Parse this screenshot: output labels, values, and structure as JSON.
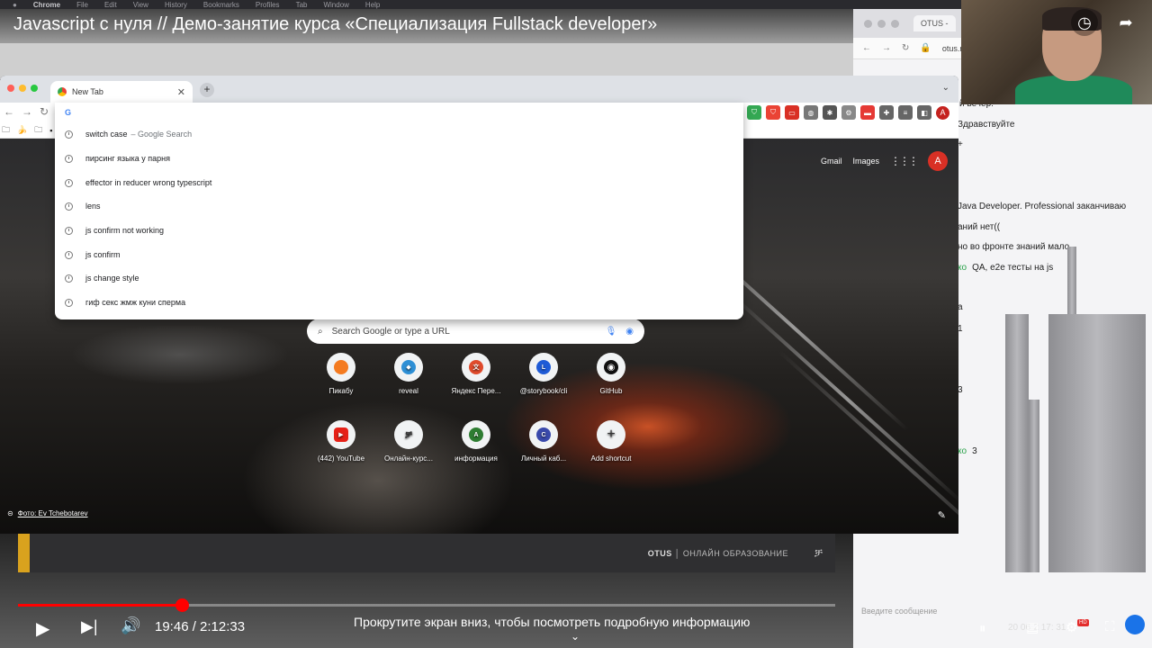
{
  "mac_menu": {
    "items": [
      "Chrome",
      "File",
      "Edit",
      "View",
      "History",
      "Bookmarks",
      "Profiles",
      "Tab",
      "Window",
      "Help"
    ]
  },
  "video": {
    "title": "Javascript с нуля // Демо-занятие курса «Специализация Fullstack developer»",
    "time_current": "19:46",
    "time_total": "2:12:33",
    "time_display": "19:46 / 2:12:33",
    "progress": 0.2,
    "scroll_hint": "Прокрутите экран вниз, чтобы посмотреть подробную информацию",
    "hd_badge": "HD",
    "brand_name": "OTUS",
    "brand_tagline": "ОНЛАЙН ОБРАЗОВАНИЕ"
  },
  "browser": {
    "tab_title": "New Tab",
    "omnibox_letter": "G",
    "profile_initial": "A",
    "suggestions": [
      {
        "text": "switch case",
        "suffix": "– Google Search"
      },
      {
        "text": "пирсинг языка у парня",
        "suffix": ""
      },
      {
        "text": "effector in reducer wrong typescript",
        "suffix": ""
      },
      {
        "text": "lens",
        "suffix": ""
      },
      {
        "text": "js confirm not working",
        "suffix": ""
      },
      {
        "text": "js confirm",
        "suffix": ""
      },
      {
        "text": "js change style",
        "suffix": ""
      },
      {
        "text": "гиф секс жмж куни сперма",
        "suffix": ""
      }
    ]
  },
  "ntp": {
    "links": {
      "gmail": "Gmail",
      "images": "Images"
    },
    "avatar_initial": "A",
    "search_placeholder": "Search Google or type a URL",
    "shortcuts_row1": [
      {
        "label": "Пикабу",
        "icon": "pikabu-icon",
        "color": "#f47b20",
        "glyph": ""
      },
      {
        "label": "reveal",
        "icon": "reveal-icon",
        "color": "#2d8fd5",
        "glyph": "◆"
      },
      {
        "label": "Яндекс Пере...",
        "icon": "yandex-translate-icon",
        "color": "#e04b2c",
        "glyph": "文"
      },
      {
        "label": "@storybook/cli",
        "icon": "storybook-icon",
        "color": "#1e5bd6",
        "glyph": "L"
      },
      {
        "label": "GitHub",
        "icon": "github-icon",
        "color": "#ffffff",
        "glyph": "◉"
      }
    ],
    "shortcuts_row2": [
      {
        "label": "(442) YouTube",
        "icon": "youtube-icon",
        "color": "#e62117",
        "glyph": "▶"
      },
      {
        "label": "Онлайн-курс...",
        "icon": "otus-icon",
        "color": "#f1f3f4",
        "glyph": "ቻ"
      },
      {
        "label": "информация",
        "icon": "letter-a-icon",
        "color": "#2e7d32",
        "glyph": "A"
      },
      {
        "label": "Личный каб...",
        "icon": "letter-c-icon",
        "color": "#3949ab",
        "glyph": "C"
      },
      {
        "label": "Add shortcut",
        "icon": "plus-icon",
        "color": "#f1f3f4",
        "glyph": "+"
      }
    ],
    "photo_credit": "Фото: Ev Tchebotarev"
  },
  "right_browser": {
    "tab_title": "OTUS -",
    "url": "otus.r"
  },
  "chat": {
    "lines": [
      {
        "nick": "",
        "text": "й вечер!"
      },
      {
        "nick": "",
        "text": "Здравствуйте"
      },
      {
        "nick": "",
        "text": "+"
      },
      {
        "nick": "",
        "text": "Java Developer. Professional заканчиваю"
      },
      {
        "nick": "",
        "text": "аний нет(("
      },
      {
        "nick": "",
        "text": "но во фронте знаний мало"
      },
      {
        "nick": "ко",
        "text": "QA, e2e тесты на js"
      },
      {
        "nick": "",
        "text": "а"
      },
      {
        "nick": "",
        "text": "1"
      },
      {
        "nick": "",
        "text": "3"
      },
      {
        "nick": "ко",
        "text": "3"
      }
    ],
    "input_placeholder": "Введите сообщение",
    "timestamp_fragment": "20   06-2   17:  31"
  }
}
